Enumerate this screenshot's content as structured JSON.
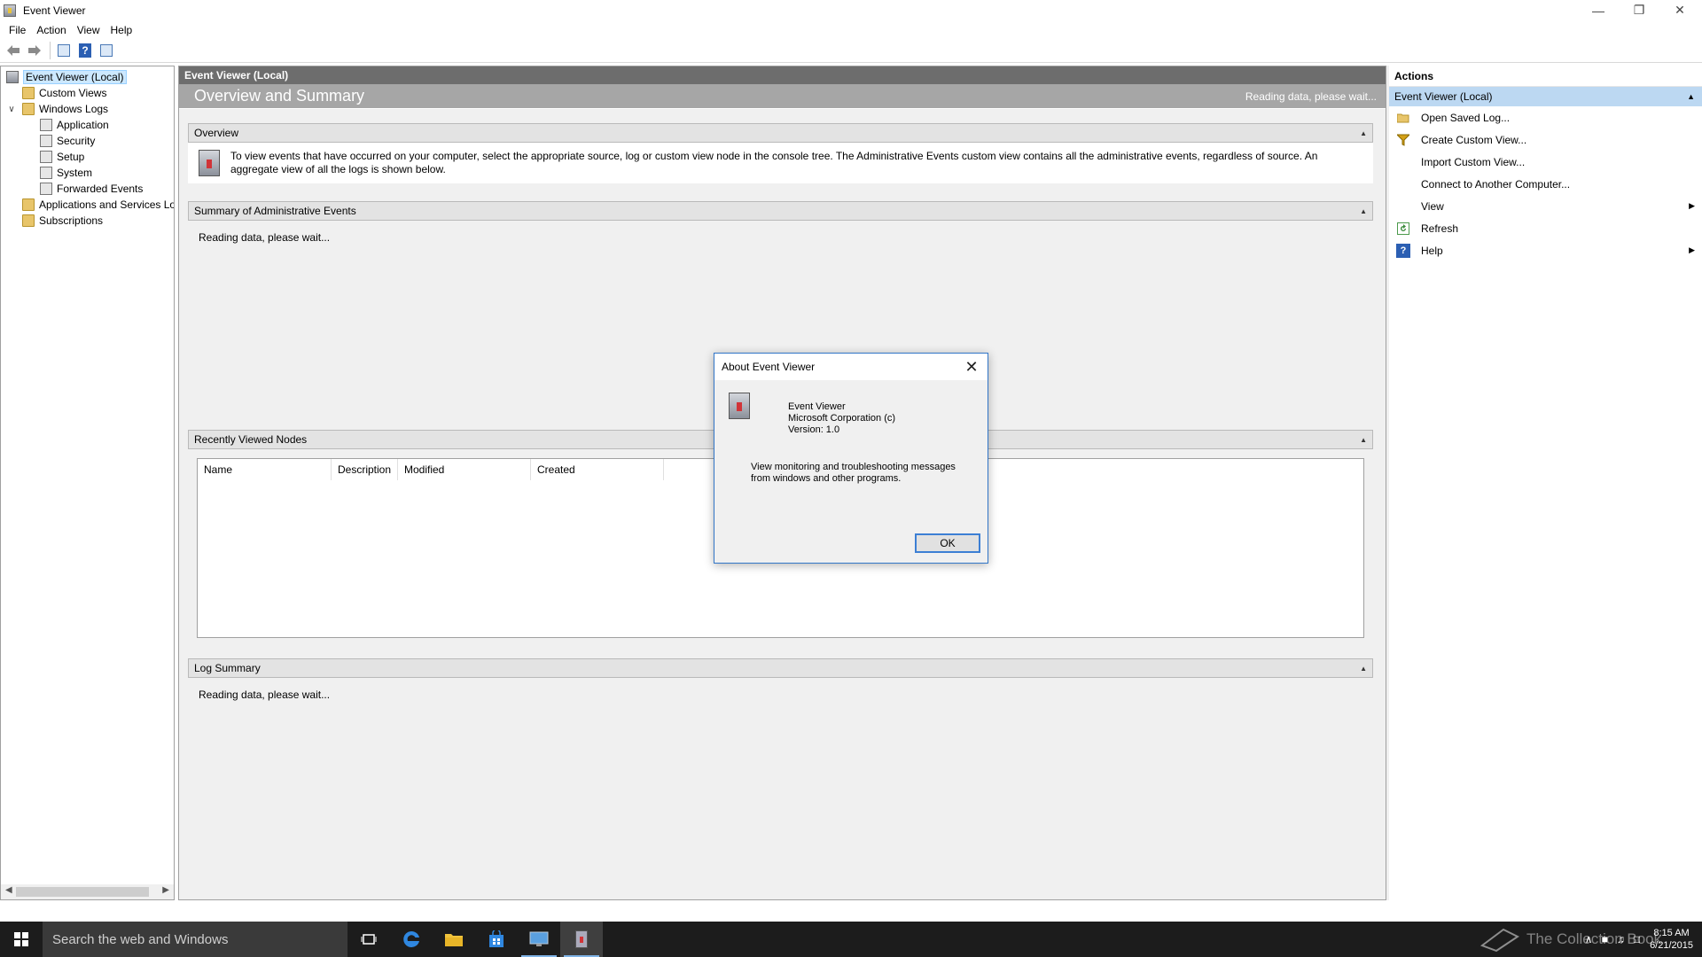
{
  "window": {
    "title": "Event Viewer",
    "controls": {
      "minimize": "—",
      "restore": "❐",
      "close": "✕"
    }
  },
  "menu": [
    "File",
    "Action",
    "View",
    "Help"
  ],
  "toolbar": {
    "back_icon": "back-arrow-icon",
    "forward_icon": "forward-arrow-icon",
    "help_glyph": "?"
  },
  "tree": {
    "items": [
      {
        "label": "Event Viewer (Local)",
        "icon": "event-viewer-icon",
        "selected": true
      },
      {
        "label": "Custom Views",
        "icon": "folder-icon"
      },
      {
        "label": "Windows Logs",
        "icon": "folder-icon",
        "expanded": true
      },
      {
        "label": "Application",
        "icon": "log-icon"
      },
      {
        "label": "Security",
        "icon": "log-icon"
      },
      {
        "label": "Setup",
        "icon": "log-icon"
      },
      {
        "label": "System",
        "icon": "log-icon"
      },
      {
        "label": "Forwarded Events",
        "icon": "log-icon"
      },
      {
        "label": "Applications and Services Lo",
        "icon": "folder-icon"
      },
      {
        "label": "Subscriptions",
        "icon": "folder-icon"
      }
    ]
  },
  "center": {
    "header": "Event Viewer (Local)",
    "title": "Overview and Summary",
    "status": "Reading data, please wait...",
    "overview": {
      "label": "Overview",
      "text": "To view events that have occurred on your computer, select the appropriate source, log or custom view node in the console tree. The Administrative Events custom view contains all the administrative events, regardless of source. An aggregate view of all the logs is shown below."
    },
    "summary": {
      "label": "Summary of Administrative Events",
      "reading": "Reading data, please wait..."
    },
    "recent": {
      "label": "Recently Viewed Nodes",
      "columns": [
        "Name",
        "Description",
        "Modified",
        "Created"
      ]
    },
    "log_summary": {
      "label": "Log Summary",
      "reading": "Reading data, please wait..."
    }
  },
  "actions": {
    "header": "Actions",
    "group": "Event Viewer (Local)",
    "items": [
      {
        "label": "Open Saved Log...",
        "icon": "open-log-icon"
      },
      {
        "label": "Create Custom View...",
        "icon": "filter-icon"
      },
      {
        "label": "Import Custom View...",
        "icon": ""
      },
      {
        "label": "Connect to Another Computer...",
        "icon": ""
      },
      {
        "label": "View",
        "icon": "",
        "submenu": true
      },
      {
        "label": "Refresh",
        "icon": "refresh-icon"
      },
      {
        "label": "Help",
        "icon": "help-icon",
        "submenu": true
      }
    ]
  },
  "dialog": {
    "title": "About Event Viewer",
    "name": "Event Viewer",
    "company": "Microsoft Corporation (c)",
    "version": "Version: 1.0",
    "description": "View monitoring and troubleshooting messages from windows and other programs.",
    "ok": "OK"
  },
  "taskbar": {
    "search_placeholder": "Search the web and Windows",
    "time": "8:15 AM",
    "date": "6/21/2015",
    "watermark": "The Collection Book"
  }
}
